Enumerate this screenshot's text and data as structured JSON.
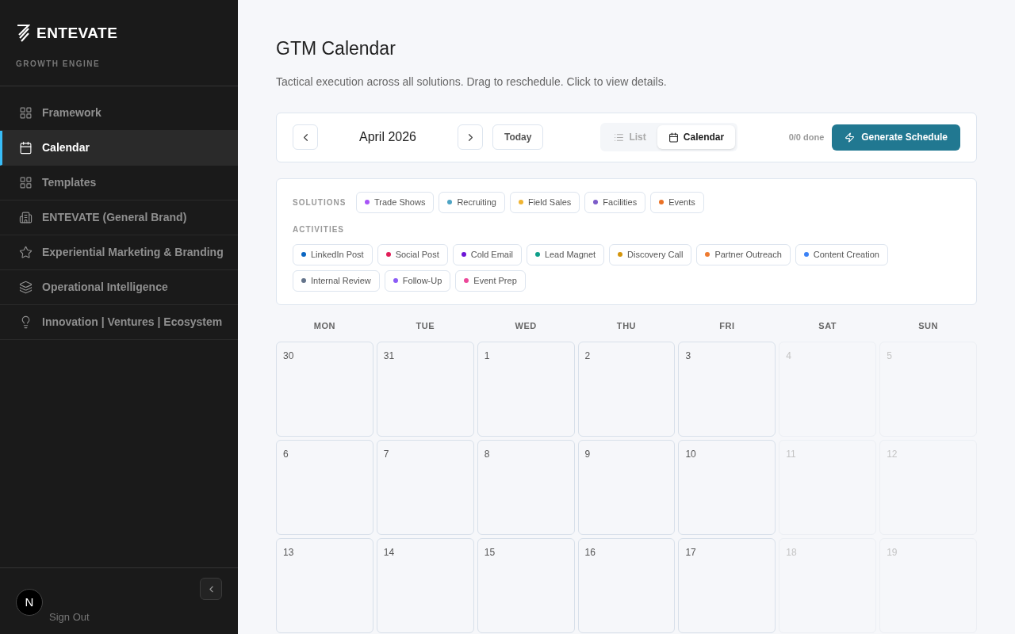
{
  "sidebar": {
    "brand": "ENTEVATE",
    "tagline": "GROWTH ENGINE",
    "items": [
      {
        "label": "Framework",
        "selected": false
      },
      {
        "label": "Calendar",
        "selected": true
      },
      {
        "label": "Templates",
        "selected": false
      },
      {
        "label": "ENTEVATE (General Brand)",
        "selected": false
      },
      {
        "label": "Experiential Marketing & Branding",
        "selected": false
      },
      {
        "label": "Operational Intelligence",
        "selected": false
      },
      {
        "label": "Innovation | Ventures | Ecosystem",
        "selected": false
      }
    ],
    "avatar": "N",
    "sign_out": "Sign Out"
  },
  "page": {
    "title": "GTM Calendar",
    "subtitle": "Tactical execution across all solutions. Drag to reschedule. Click to view details."
  },
  "toolbar": {
    "month": "April 2026",
    "today": "Today",
    "views": [
      {
        "label": "List",
        "selected": false
      },
      {
        "label": "Calendar",
        "selected": true
      }
    ],
    "progress": "0/0 done",
    "generate": "Generate Schedule"
  },
  "filters": {
    "solutions_label": "SOLUTIONS",
    "solutions": [
      {
        "label": "Trade Shows",
        "color": "#a855f7"
      },
      {
        "label": "Recruiting",
        "color": "#4ea4c4"
      },
      {
        "label": "Field Sales",
        "color": "#f0b432"
      },
      {
        "label": "Facilities",
        "color": "#7c5cc9"
      },
      {
        "label": "Events",
        "color": "#ea7125"
      }
    ],
    "activities_label": "ACTIVITIES",
    "activities": [
      {
        "label": "LinkedIn Post",
        "color": "#0a66c2"
      },
      {
        "label": "Social Post",
        "color": "#e11d58"
      },
      {
        "label": "Cold Email",
        "color": "#6d16d6"
      },
      {
        "label": "Lead Magnet",
        "color": "#0e9f8a"
      },
      {
        "label": "Discovery Call",
        "color": "#d4950b"
      },
      {
        "label": "Partner Outreach",
        "color": "#ee7b30"
      },
      {
        "label": "Content Creation",
        "color": "#3b82f6"
      },
      {
        "label": "Internal Review",
        "color": "#64748b"
      },
      {
        "label": "Follow-Up",
        "color": "#8b5cf6"
      },
      {
        "label": "Event Prep",
        "color": "#ec4899"
      }
    ]
  },
  "calendar": {
    "weekdays": [
      "MON",
      "TUE",
      "WED",
      "THU",
      "FRI",
      "SAT",
      "SUN"
    ],
    "weeks": [
      [
        {
          "day": "30",
          "dimmed": false
        },
        {
          "day": "31",
          "dimmed": false
        },
        {
          "day": "1",
          "dimmed": false
        },
        {
          "day": "2",
          "dimmed": false
        },
        {
          "day": "3",
          "dimmed": false
        },
        {
          "day": "4",
          "dimmed": true
        },
        {
          "day": "5",
          "dimmed": true
        }
      ],
      [
        {
          "day": "6",
          "dimmed": false
        },
        {
          "day": "7",
          "dimmed": false
        },
        {
          "day": "8",
          "dimmed": false
        },
        {
          "day": "9",
          "dimmed": false
        },
        {
          "day": "10",
          "dimmed": false
        },
        {
          "day": "11",
          "dimmed": true
        },
        {
          "day": "12",
          "dimmed": true
        }
      ],
      [
        {
          "day": "13",
          "dimmed": false
        },
        {
          "day": "14",
          "dimmed": false
        },
        {
          "day": "15",
          "dimmed": false
        },
        {
          "day": "16",
          "dimmed": false
        },
        {
          "day": "17",
          "dimmed": false
        },
        {
          "day": "18",
          "dimmed": true
        },
        {
          "day": "19",
          "dimmed": true
        }
      ]
    ]
  }
}
